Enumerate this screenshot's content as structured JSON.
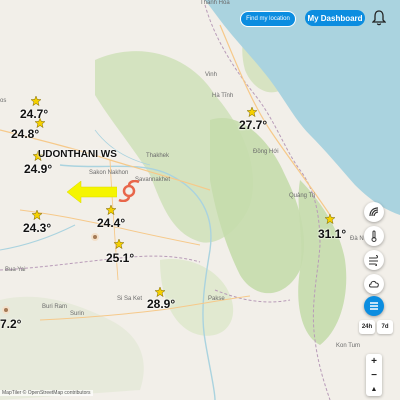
{
  "header": {
    "find_location_label": "Find my location",
    "dashboard_label": "My Dashboard",
    "bell_icon": "bell-icon"
  },
  "map": {
    "places": [
      {
        "id": "thanh-hoa",
        "label": "Thanh Hóa"
      },
      {
        "id": "vinh",
        "label": "Vinh"
      },
      {
        "id": "ha-tinh",
        "label": "Hà Tĩnh"
      },
      {
        "id": "dong-hoi",
        "label": "Đồng Hới"
      },
      {
        "id": "quang-tri",
        "label": "Quảng Trị"
      },
      {
        "id": "da-nang",
        "label": "Đà N"
      },
      {
        "id": "sakon-nakhon",
        "label": "Sakon Nakhon"
      },
      {
        "id": "thakhek",
        "label": "Thakhek"
      },
      {
        "id": "savannakhet",
        "label": "Savannakhet"
      },
      {
        "id": "bua-yai",
        "label": "Bua Yai"
      },
      {
        "id": "buri-ram",
        "label": "Buri Ram"
      },
      {
        "id": "surin",
        "label": "Surin"
      },
      {
        "id": "si-sa-ket",
        "label": "Si Sa Ket"
      },
      {
        "id": "pakse",
        "label": "Pakse"
      },
      {
        "id": "kon-tum",
        "label": "Kon Tum"
      },
      {
        "id": "os",
        "label": "os"
      }
    ],
    "temperatures": [
      {
        "id": "t1",
        "value": "24.7°"
      },
      {
        "id": "t2",
        "value": "24.8°"
      },
      {
        "id": "t3",
        "value": "24.9°"
      },
      {
        "id": "t4",
        "value": "24.3°"
      },
      {
        "id": "t5",
        "value": "24.4°"
      },
      {
        "id": "t6",
        "value": "25.1°"
      },
      {
        "id": "t7",
        "value": "28.9°"
      },
      {
        "id": "t8",
        "value": "27.7°"
      },
      {
        "id": "t9",
        "value": "31.1°"
      },
      {
        "id": "t10",
        "value": "7.2°"
      }
    ],
    "station_label": "UDONTHANI WS",
    "highlight_arrow_color": "#f5f500",
    "cyclone_color": "#e8664a"
  },
  "controls": {
    "range_24h": "24h",
    "range_7d": "7d",
    "zoom_in": "+",
    "zoom_out": "−",
    "compass": "▲",
    "layer_icons": [
      "cyclone-layer-icon",
      "temperature-layer-icon",
      "wind-layer-icon",
      "cloud-layer-icon",
      "list-layer-icon"
    ]
  },
  "attribution": "MapTiler © OpenStreetMap contributors",
  "colors": {
    "accent": "#0b8de0",
    "sea": "#aad3df",
    "land": "#f2efe9",
    "forest": "#c8dcb0",
    "star": "#f5d000"
  }
}
